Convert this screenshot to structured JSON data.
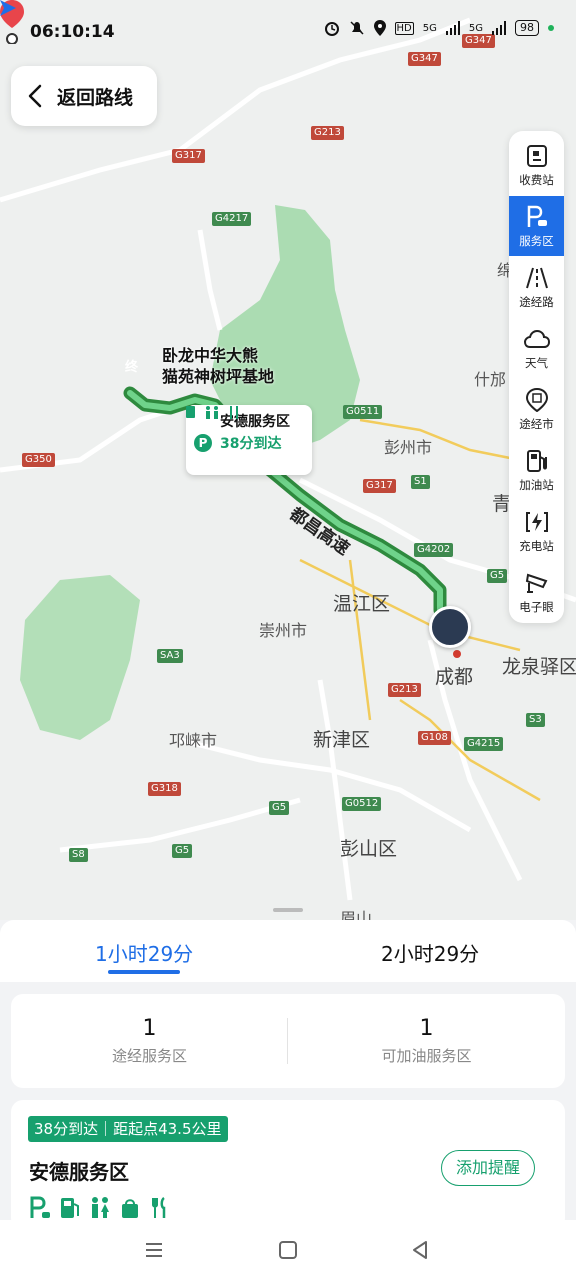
{
  "status_bar": {
    "time": "06:10:14",
    "network1": "5G",
    "network2": "5G",
    "hd": "HD",
    "battery": "98"
  },
  "back_button": {
    "label": "返回路线"
  },
  "side_panel": {
    "items": [
      {
        "label": "收费站",
        "icon": "toll-station-icon"
      },
      {
        "label": "服务区",
        "icon": "service-area-icon",
        "active": true
      },
      {
        "label": "途经路",
        "icon": "road-icon"
      },
      {
        "label": "天气",
        "icon": "weather-icon"
      },
      {
        "label": "途经市",
        "icon": "city-icon"
      },
      {
        "label": "加油站",
        "icon": "gas-station-icon"
      },
      {
        "label": "充电站",
        "icon": "charging-station-icon"
      },
      {
        "label": "电子眼",
        "icon": "camera-icon"
      }
    ]
  },
  "map": {
    "destination_pin": "终",
    "destination": "卧龙中华大熊\n猫苑神树坪基地",
    "place_labels": [
      "彭州市",
      "温江区",
      "崇州市",
      "成都",
      "龙泉驿区",
      "邛崃市",
      "新津区",
      "彭山区",
      "什邡",
      "绵",
      "青",
      "眉山"
    ],
    "road_tags": [
      "G347",
      "G347",
      "G213",
      "G317",
      "G4217",
      "G0511",
      "G317",
      "S1",
      "G4202",
      "G5",
      "G350",
      "SA3",
      "G213",
      "G108",
      "G4215",
      "S3",
      "G318",
      "G5",
      "G0512",
      "S8",
      "G5"
    ],
    "highway_name": "都昌高速"
  },
  "service_card": {
    "name": "安德服务区",
    "eta": "38分到达",
    "icon": "service-area-icon"
  },
  "route_tabs": [
    {
      "label": "1小时29分",
      "active": true
    },
    {
      "label": "2小时29分",
      "active": false
    }
  ],
  "stats": [
    {
      "value": "1",
      "caption": "途经服务区"
    },
    {
      "value": "1",
      "caption": "可加油服务区"
    }
  ],
  "service_detail": {
    "eta_badge": "38分到达｜距起点43.5公里",
    "name": "安德服务区",
    "remind_button": "添加提醒",
    "amenities": [
      "parking-icon",
      "gas-icon",
      "restroom-icon",
      "shop-icon",
      "restaurant-icon"
    ]
  },
  "colors": {
    "accent_blue": "#1f6ee6",
    "route_green": "#17a06e",
    "park_green": "#9fd8a7"
  }
}
